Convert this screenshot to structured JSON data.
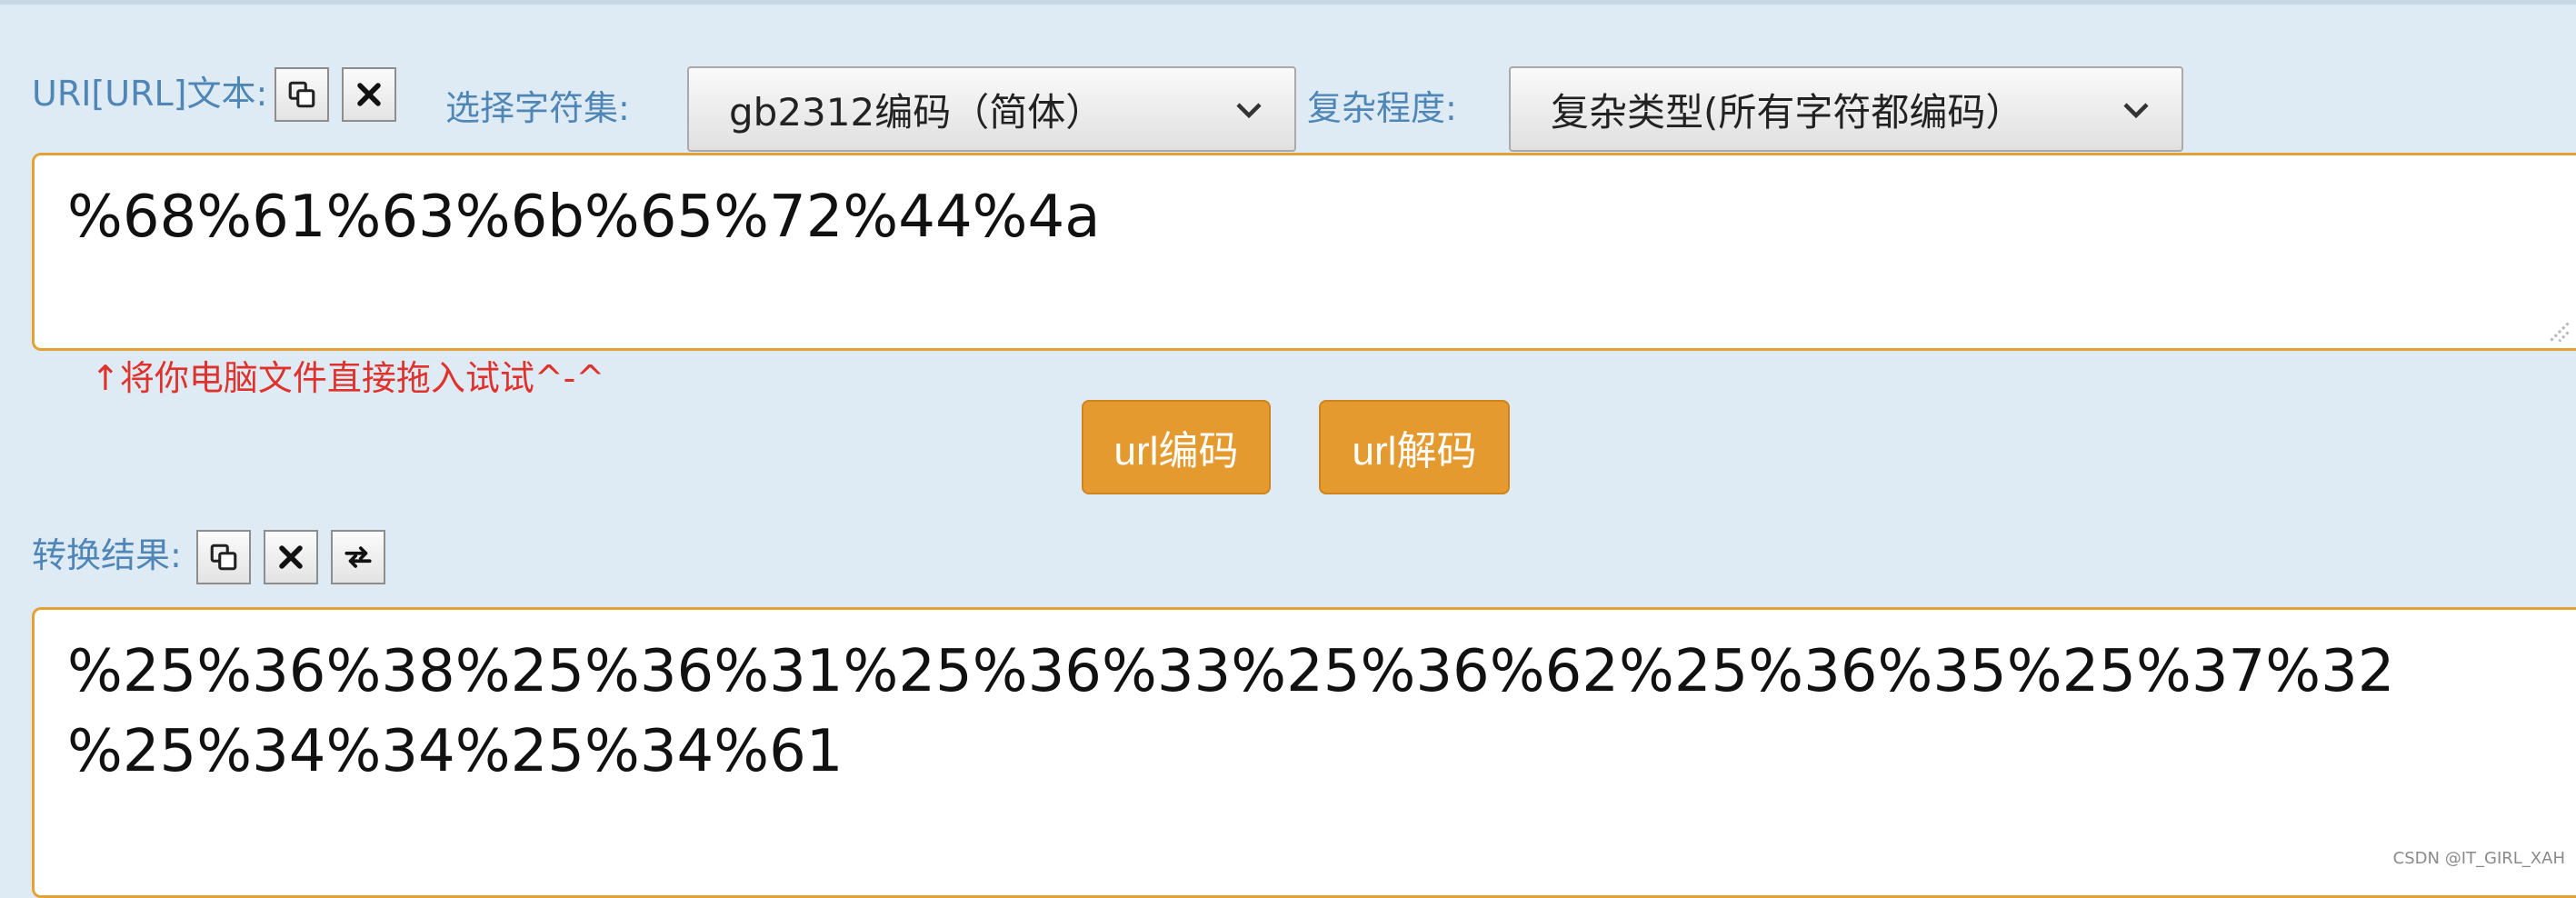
{
  "encoder": {
    "input_label": "URI[URL]文本:",
    "charset_label": "选择字符集:",
    "charset_value": "gb2312编码（简体）",
    "complexity_label": "复杂程度:",
    "complexity_value": "复杂类型(所有字符都编码）",
    "input_text": "%68%61%63%6b%65%72%44%4a",
    "drop_hint": "↑将你电脑文件直接拖入试试^-^",
    "encode_button": "url编码",
    "decode_button": "url解码",
    "result_label": "转换结果:",
    "result_text": "%25%36%38%25%36%31%25%36%33%25%36%62%25%36%35%25%37%32\n%25%34%34%25%34%61"
  },
  "icons": {
    "copy": "copy-icon",
    "clear": "close-icon",
    "swap": "swap-icon",
    "dropdown": "chevron-down-icon"
  },
  "colors": {
    "background": "#deebf4",
    "label": "#4f86b5",
    "accent": "#e59a2f",
    "textarea_border": "#e5a136",
    "hint": "#e0322c"
  },
  "watermark": "CSDN @IT_GIRL_XAH"
}
